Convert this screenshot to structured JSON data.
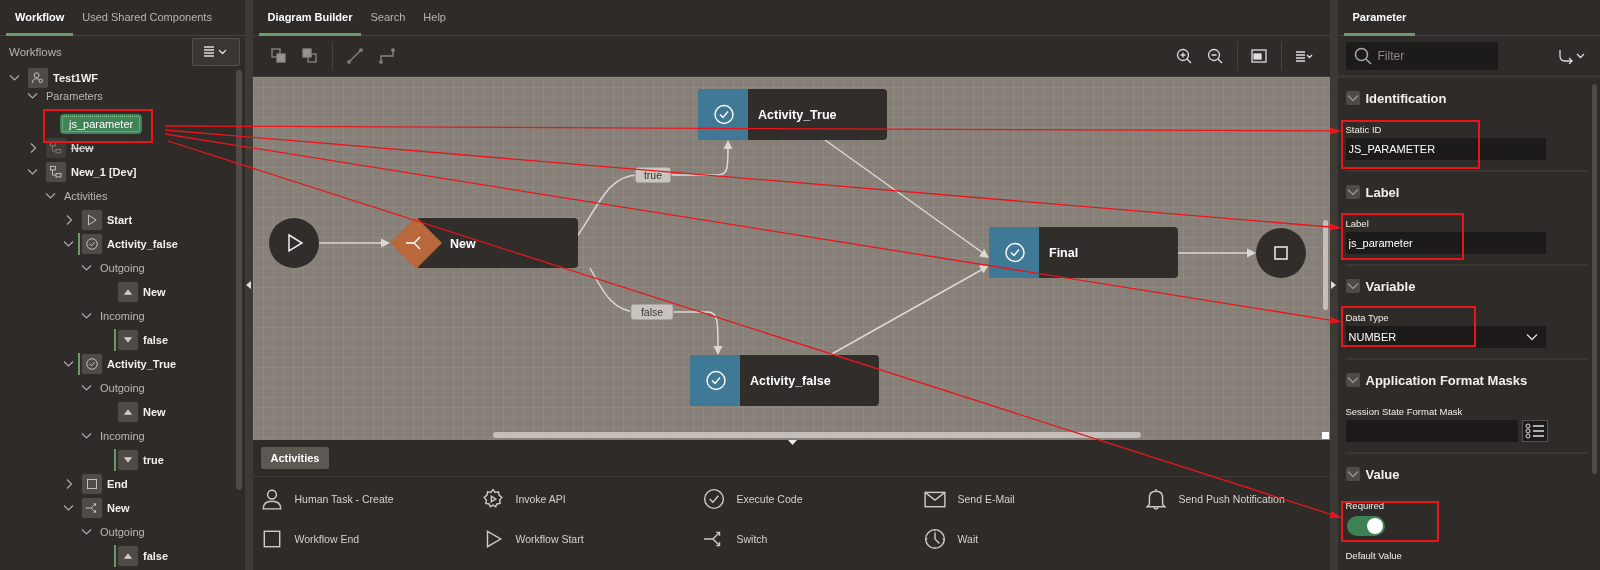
{
  "left_panel": {
    "tabs": [
      {
        "label": "Workflow",
        "selected": true
      },
      {
        "label": "Used Shared Components",
        "selected": false
      }
    ],
    "heading": "Workflows",
    "tree": [
      {
        "label": "Test1WF",
        "kind": "workflow",
        "expanded": true,
        "selected": false,
        "children": [
          {
            "label": "Parameters",
            "kind": "group",
            "expanded": true,
            "selected": false,
            "children": [
              {
                "label": "js_parameter",
                "kind": "parameter",
                "selected": true
              }
            ]
          },
          {
            "label": "New",
            "kind": "version",
            "expanded": false,
            "selected": false,
            "disabled": true
          },
          {
            "label": "New_1 [Dev]",
            "kind": "version",
            "expanded": true,
            "selected": false,
            "children": [
              {
                "label": "Activities",
                "kind": "group",
                "expanded": true,
                "selected": false,
                "children": [
                  {
                    "label": "Start",
                    "kind": "start",
                    "expanded": false,
                    "selected": false
                  },
                  {
                    "label": "Activity_false",
                    "kind": "activity",
                    "expanded": true,
                    "selected": false,
                    "linked": true,
                    "children": [
                      {
                        "label": "Outgoing",
                        "kind": "group",
                        "expanded": true,
                        "selected": false,
                        "children": [
                          {
                            "label": "New",
                            "kind": "outgoing",
                            "selected": false
                          }
                        ]
                      },
                      {
                        "label": "Incoming",
                        "kind": "group",
                        "expanded": true,
                        "selected": false,
                        "children": [
                          {
                            "label": "false",
                            "kind": "incoming",
                            "selected": false,
                            "linked": true
                          }
                        ]
                      }
                    ]
                  },
                  {
                    "label": "Activity_True",
                    "kind": "activity",
                    "expanded": true,
                    "selected": false,
                    "linked": true,
                    "children": [
                      {
                        "label": "Outgoing",
                        "kind": "group",
                        "expanded": true,
                        "selected": false,
                        "children": [
                          {
                            "label": "New",
                            "kind": "outgoing",
                            "selected": false
                          }
                        ]
                      },
                      {
                        "label": "Incoming",
                        "kind": "group",
                        "expanded": true,
                        "selected": false,
                        "children": [
                          {
                            "label": "true",
                            "kind": "incoming",
                            "selected": false,
                            "linked": true
                          }
                        ]
                      }
                    ]
                  },
                  {
                    "label": "End",
                    "kind": "end",
                    "expanded": false,
                    "selected": false
                  },
                  {
                    "label": "New",
                    "kind": "switch",
                    "expanded": true,
                    "selected": false,
                    "children": [
                      {
                        "label": "Outgoing",
                        "kind": "group",
                        "expanded": true,
                        "selected": false,
                        "children": [
                          {
                            "label": "false",
                            "kind": "outgoing",
                            "selected": false,
                            "linked": true
                          }
                        ]
                      }
                    ]
                  }
                ]
              }
            ]
          }
        ]
      }
    ]
  },
  "center": {
    "tabs": [
      {
        "label": "Diagram Builder",
        "selected": true
      },
      {
        "label": "Search",
        "selected": false
      },
      {
        "label": "Help",
        "selected": false
      }
    ],
    "diagram": {
      "nodes": [
        {
          "kind": "start"
        },
        {
          "kind": "switch",
          "label": "New"
        },
        {
          "kind": "activity",
          "label": "Activity_True"
        },
        {
          "kind": "activity",
          "label": "Final"
        },
        {
          "kind": "end"
        },
        {
          "kind": "activity",
          "label": "Activity_false"
        }
      ],
      "edge_labels": [
        {
          "label": "true"
        },
        {
          "label": "false"
        }
      ]
    },
    "palette": {
      "tab": "Activities",
      "items": [
        {
          "kind": "human-task",
          "label": "Human Task - Create"
        },
        {
          "kind": "invoke-api",
          "label": "Invoke API"
        },
        {
          "kind": "execute-code",
          "label": "Execute Code"
        },
        {
          "kind": "send-email",
          "label": "Send E-Mail"
        },
        {
          "kind": "push-notification",
          "label": "Send Push Notification"
        },
        {
          "kind": "workflow-end",
          "label": "Workflow End"
        },
        {
          "kind": "workflow-start",
          "label": "Workflow Start"
        },
        {
          "kind": "switch",
          "label": "Switch"
        },
        {
          "kind": "wait",
          "label": "Wait"
        }
      ]
    }
  },
  "right_panel": {
    "tabs": [
      {
        "label": "Parameter",
        "selected": true
      }
    ],
    "filter": {
      "placeholder": "Filter"
    },
    "sections": [
      {
        "title": "Identification",
        "expanded": true,
        "fields": [
          {
            "kind": "text",
            "label": "Static ID",
            "value": "JS_PARAMETER"
          }
        ]
      },
      {
        "title": "Label",
        "expanded": true,
        "fields": [
          {
            "kind": "text",
            "label": "Label",
            "value": "js_parameter"
          }
        ]
      },
      {
        "title": "Variable",
        "expanded": true,
        "fields": [
          {
            "kind": "select",
            "label": "Data Type",
            "value": "NUMBER"
          }
        ]
      },
      {
        "title": "Application Format Masks",
        "expanded": true,
        "fields": [
          {
            "kind": "picker",
            "label": "Session State Format Mask"
          }
        ]
      },
      {
        "title": "Value",
        "expanded": true,
        "fields": [
          {
            "kind": "switch",
            "label": "Required",
            "on": true
          },
          {
            "kind": "label",
            "label": "Default Value"
          }
        ]
      }
    ]
  }
}
